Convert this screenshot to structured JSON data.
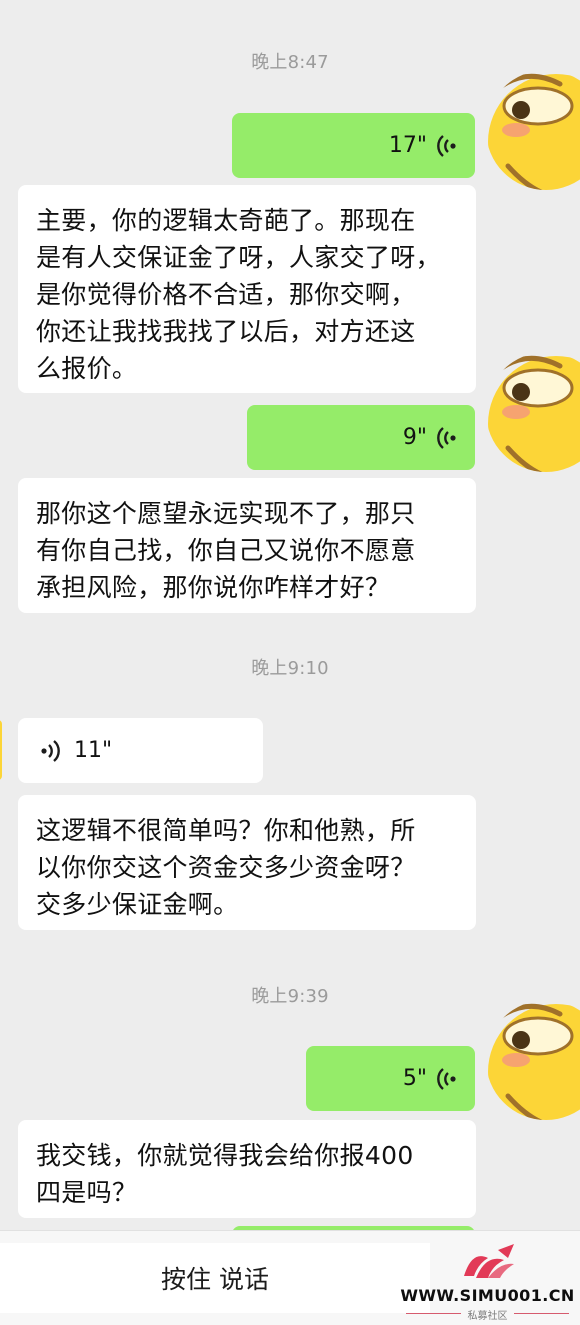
{
  "timestamps": [
    "晚上8:47",
    "晚上9:10",
    "晚上9:39"
  ],
  "messages": [
    {
      "type": "voice",
      "side": "right",
      "duration": "17\""
    },
    {
      "type": "text",
      "side": "left",
      "text": "主要，你的逻辑太奇葩了。那现在\n是有人交保证金了呀，人家交了呀，\n是你觉得价格不合适，那你交啊，\n你还让我找我找了以后，对方还这\n么报价。"
    },
    {
      "type": "voice",
      "side": "right",
      "duration": "9\""
    },
    {
      "type": "text",
      "side": "left",
      "text": "那你这个愿望永远实现不了，那只\n有你自己找，你自己又说你不愿意\n承担风险，那你说你咋样才好？"
    },
    {
      "type": "voice",
      "side": "left",
      "duration": "11\""
    },
    {
      "type": "text",
      "side": "left",
      "text": "这逻辑不很简单吗？你和他熟，所\n以你你交这个资金交多少资金呀？\n交多少保证金啊。"
    },
    {
      "type": "voice",
      "side": "right",
      "duration": "5\""
    },
    {
      "type": "text",
      "side": "left",
      "text": "我交钱，你就觉得我会给你报400\n四是吗？"
    }
  ],
  "input": {
    "hold_to_talk": "按住 说话"
  },
  "watermark": {
    "url": "WWW.SIMU001.CN",
    "subtitle": "私募社区"
  },
  "colors": {
    "background": "#ededed",
    "self_bubble": "#95ec69",
    "other_bubble": "#ffffff",
    "timestamp": "#9b9b9b",
    "avatar_yellow": "#fcd537"
  },
  "icons": {
    "voice": "voice-wave-icon",
    "avatar": "smirk-emoji-avatar"
  }
}
